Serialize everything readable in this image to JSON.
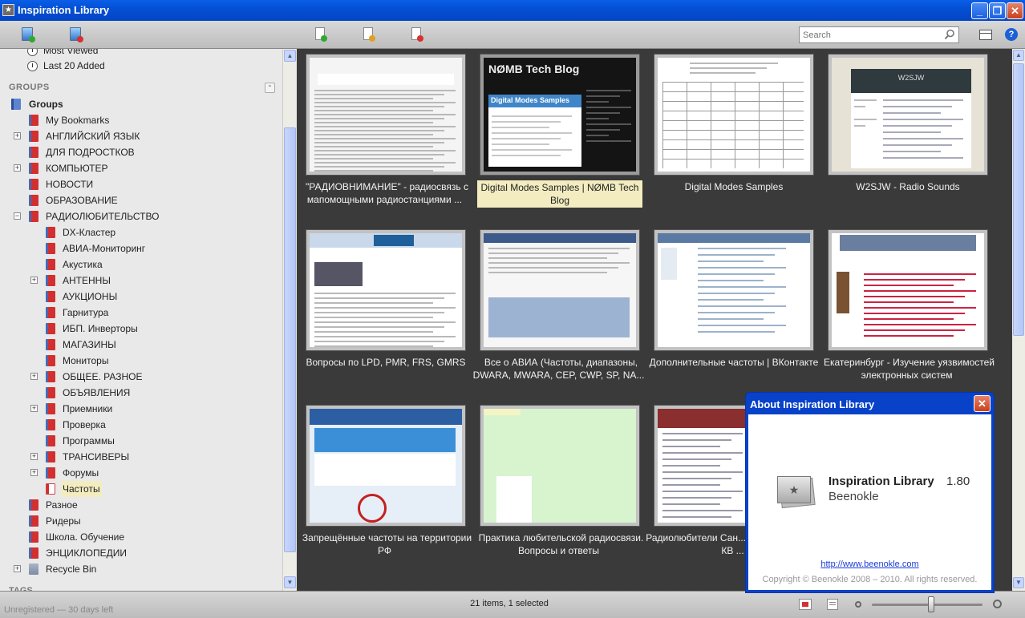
{
  "window": {
    "title": "Inspiration Library"
  },
  "search": {
    "placeholder": "Search"
  },
  "sidebar": {
    "top_items": [
      "Most Viewed",
      "Last 20 Added"
    ],
    "groups_header": "GROUPS",
    "root": "Groups",
    "items": [
      {
        "label": "My Bookmarks",
        "level": 1,
        "expander": "",
        "icon": "red-book-icon"
      },
      {
        "label": "АНГЛИЙСКИЙ ЯЗЫК",
        "level": 1,
        "expander": "+",
        "icon": "red-book-icon"
      },
      {
        "label": "ДЛЯ ПОДРОСТКОВ",
        "level": 1,
        "expander": "",
        "icon": "red-book-icon"
      },
      {
        "label": "КОМПЬЮТЕР",
        "level": 1,
        "expander": "+",
        "icon": "red-book-icon"
      },
      {
        "label": "НОВОСТИ",
        "level": 1,
        "expander": "",
        "icon": "red-book-icon"
      },
      {
        "label": "ОБРАЗОВАНИЕ",
        "level": 1,
        "expander": "",
        "icon": "red-book-icon"
      },
      {
        "label": "РАДИОЛЮБИТЕЛЬСТВО",
        "level": 1,
        "expander": "−",
        "icon": "red-book-icon"
      },
      {
        "label": "DX-Кластер",
        "level": 2,
        "expander": "",
        "icon": "red-book-icon"
      },
      {
        "label": "АВИА-Мониторинг",
        "level": 2,
        "expander": "",
        "icon": "red-book-icon"
      },
      {
        "label": "Акустика",
        "level": 2,
        "expander": "",
        "icon": "red-book-icon"
      },
      {
        "label": "АНТЕННЫ",
        "level": 2,
        "expander": "+",
        "icon": "red-book-icon"
      },
      {
        "label": "АУКЦИОНЫ",
        "level": 2,
        "expander": "",
        "icon": "red-book-icon"
      },
      {
        "label": "Гарнитура",
        "level": 2,
        "expander": "",
        "icon": "red-book-icon"
      },
      {
        "label": "ИБП. Инверторы",
        "level": 2,
        "expander": "",
        "icon": "red-book-icon"
      },
      {
        "label": "МАГАЗИНЫ",
        "level": 2,
        "expander": "",
        "icon": "red-book-icon"
      },
      {
        "label": "Мониторы",
        "level": 2,
        "expander": "",
        "icon": "red-book-icon"
      },
      {
        "label": "ОБЩЕЕ. РАЗНОЕ",
        "level": 2,
        "expander": "+",
        "icon": "red-book-icon"
      },
      {
        "label": "ОБЪЯВЛЕНИЯ",
        "level": 2,
        "expander": "",
        "icon": "red-book-icon"
      },
      {
        "label": "Приемники",
        "level": 2,
        "expander": "+",
        "icon": "red-book-icon"
      },
      {
        "label": "Проверка",
        "level": 2,
        "expander": "",
        "icon": "red-book-icon"
      },
      {
        "label": "Программы",
        "level": 2,
        "expander": "",
        "icon": "red-book-icon"
      },
      {
        "label": "ТРАНСИВЕРЫ",
        "level": 2,
        "expander": "+",
        "icon": "red-book-icon"
      },
      {
        "label": "Форумы",
        "level": 2,
        "expander": "+",
        "icon": "red-book-icon"
      },
      {
        "label": "Частоты",
        "level": 2,
        "expander": "",
        "icon": "open-book-icon",
        "selected": true
      },
      {
        "label": "Разное",
        "level": 1,
        "expander": "",
        "icon": "red-book-icon"
      },
      {
        "label": "Ридеры",
        "level": 1,
        "expander": "",
        "icon": "red-book-icon"
      },
      {
        "label": "Школа. Обучение",
        "level": 1,
        "expander": "",
        "icon": "red-book-icon"
      },
      {
        "label": "ЭНЦИКЛОПЕДИИ",
        "level": 1,
        "expander": "",
        "icon": "red-book-icon"
      },
      {
        "label": "Recycle Bin",
        "level": 0,
        "expander": "+",
        "icon": "recycle-bin-icon"
      }
    ],
    "tags_header": "TAGS"
  },
  "cards": [
    {
      "caption": "\"РАДИОВНИМАНИЕ\" - радиосвязь с мапомощными радиостанциями ...",
      "thumb": "doc"
    },
    {
      "caption": "Digital Modes Samples | NØMB Tech Blog",
      "thumb": "blog",
      "selected": true,
      "blog_title": "NØMB Tech Blog",
      "blog_heading": "Digital Modes Samples"
    },
    {
      "caption": "Digital Modes Samples",
      "thumb": "table"
    },
    {
      "caption": "W2SJW - Radio Sounds",
      "thumb": "w2sjw",
      "site_title": "W2SJW"
    },
    {
      "caption": "Вопросы по LPD, PMR, FRS, GMRS",
      "thumb": "forum"
    },
    {
      "caption": "Все о АВИА (Частоты, диапазоны, DWARA, MWARA, CEP, CWP, SP, NA...",
      "thumb": "forum2"
    },
    {
      "caption": "Дополнительные частоты | ВКонтакте",
      "thumb": "vk"
    },
    {
      "caption": "Екатеринбург - Изучение уязвимостей электронных систем",
      "thumb": "ekb"
    },
    {
      "caption": "Запрещённые частоты на территории РФ",
      "thumb": "blue"
    },
    {
      "caption": "Практика любительской радиосвязи. Вопросы и ответы",
      "thumb": "green"
    },
    {
      "caption": "Радиолюбители Сан... Просмотр темы - КВ ...",
      "thumb": "news"
    },
    {
      "caption": "",
      "thumb": "hidden"
    }
  ],
  "status": {
    "left": "Unregistered — 30 days left",
    "center": "21 items, 1 selected",
    "zoom_level": 0.5
  },
  "about": {
    "title": "About Inspiration Library",
    "product": "Inspiration Library",
    "version": "1.80",
    "company": "Beenokle",
    "link": "http://www.beenokle.com",
    "copyright": "Copyright © Beenokle 2008 – 2010. All rights reserved."
  },
  "icons": {
    "close": "✕",
    "minimize": "_",
    "maximize": "❐",
    "help": "?",
    "star": "★"
  }
}
